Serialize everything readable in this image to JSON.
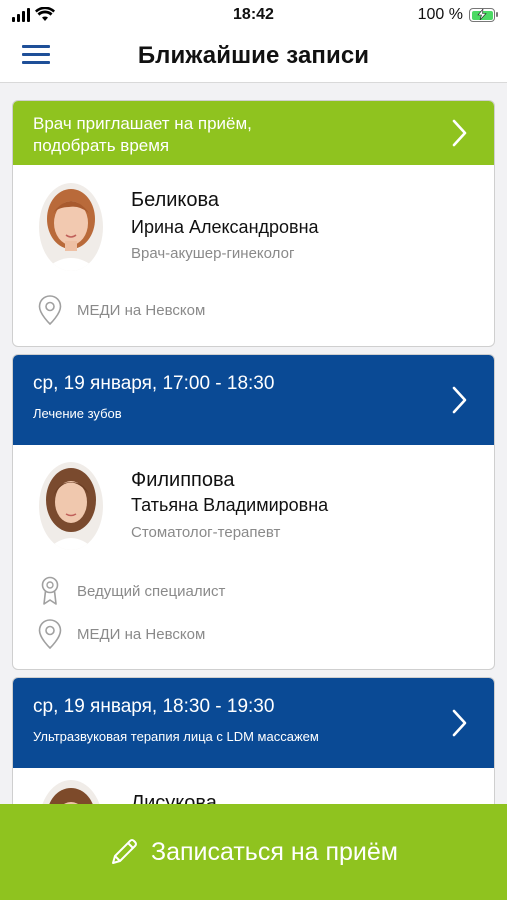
{
  "status_bar": {
    "time": "18:42",
    "battery": "100 %"
  },
  "header": {
    "title": "Ближайшие записи",
    "menu_icon": "hamburger-menu-icon"
  },
  "cards": [
    {
      "type": "invite",
      "header_text": "Врач приглашает на приём, подобрать время",
      "header_color": "#8fc31f",
      "doctor": {
        "last_name": "Беликова",
        "first_name": "Ирина Александровна",
        "specialty": "Врач-акушер-гинеколог"
      },
      "rank": "",
      "location": "МЕДИ на Невском"
    },
    {
      "type": "appointment",
      "date": "ср, 19 января, 17:00 - 18:30",
      "service": "Лечение зубов",
      "header_color": "#0a4a95",
      "doctor": {
        "last_name": "Филиппова",
        "first_name": "Татьяна Владимировна",
        "specialty": "Стоматолог-терапевт"
      },
      "rank": "Ведущий специалист",
      "location": "МЕДИ на Невском"
    },
    {
      "type": "appointment",
      "date": "ср, 19 января, 18:30 - 19:30",
      "service": "Ультразвуковая терапия лица с LDM массажем",
      "header_color": "#0a4a95",
      "doctor": {
        "last_name": "Лисукова"
      }
    }
  ],
  "book_button": {
    "label": "Записаться на приём",
    "icon": "pencil-icon",
    "color": "#8fc31f"
  }
}
